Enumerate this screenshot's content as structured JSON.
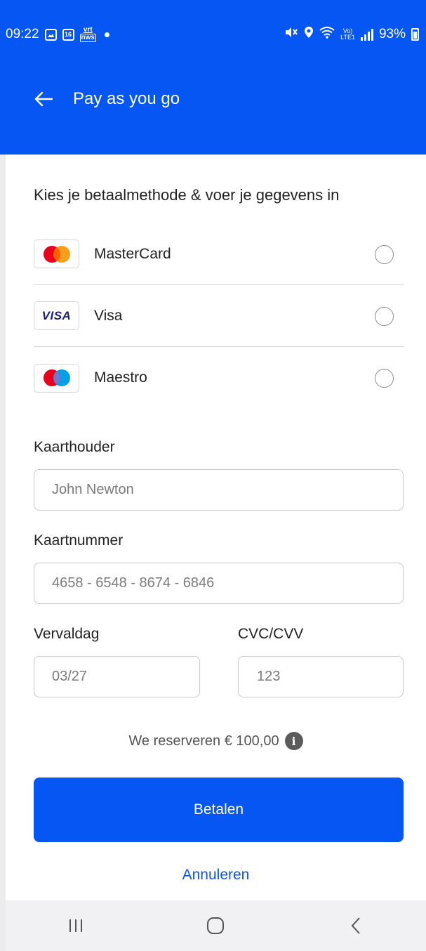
{
  "status_bar": {
    "time": "09:22",
    "calendar_day": "16",
    "news_badge_top": "vrt",
    "news_badge_bottom": "nws",
    "battery": "93%"
  },
  "header": {
    "title": "Pay as you go",
    "back_icon": "arrow-left-icon"
  },
  "payment": {
    "instruction": "Kies je betaalmethode & voer je gegevens in",
    "methods": [
      {
        "label": "MasterCard",
        "logo": "mastercard-logo",
        "selected": false
      },
      {
        "label": "Visa",
        "logo": "visa-logo",
        "logo_text": "VISA",
        "selected": false
      },
      {
        "label": "Maestro",
        "logo": "maestro-logo",
        "selected": false
      }
    ]
  },
  "form": {
    "cardholder_label": "Kaarthouder",
    "cardholder_placeholder": "John Newton",
    "cardnumber_label": "Kaartnummer",
    "cardnumber_placeholder": "4658 - 6548 - 8674 - 6846",
    "expiry_label": "Vervaldag",
    "expiry_placeholder": "03/27",
    "cvc_label": "CVC/CVV",
    "cvc_placeholder": "123"
  },
  "reserve_text": "We reserveren € 100,00",
  "info_icon": "i",
  "pay_button": "Betalen",
  "cancel_link": "Annuleren",
  "colors": {
    "brand": "#0556f2",
    "link": "#0a56e8"
  },
  "navbar": {
    "icons": [
      "recent-apps-icon",
      "home-icon",
      "back-nav-icon"
    ]
  }
}
